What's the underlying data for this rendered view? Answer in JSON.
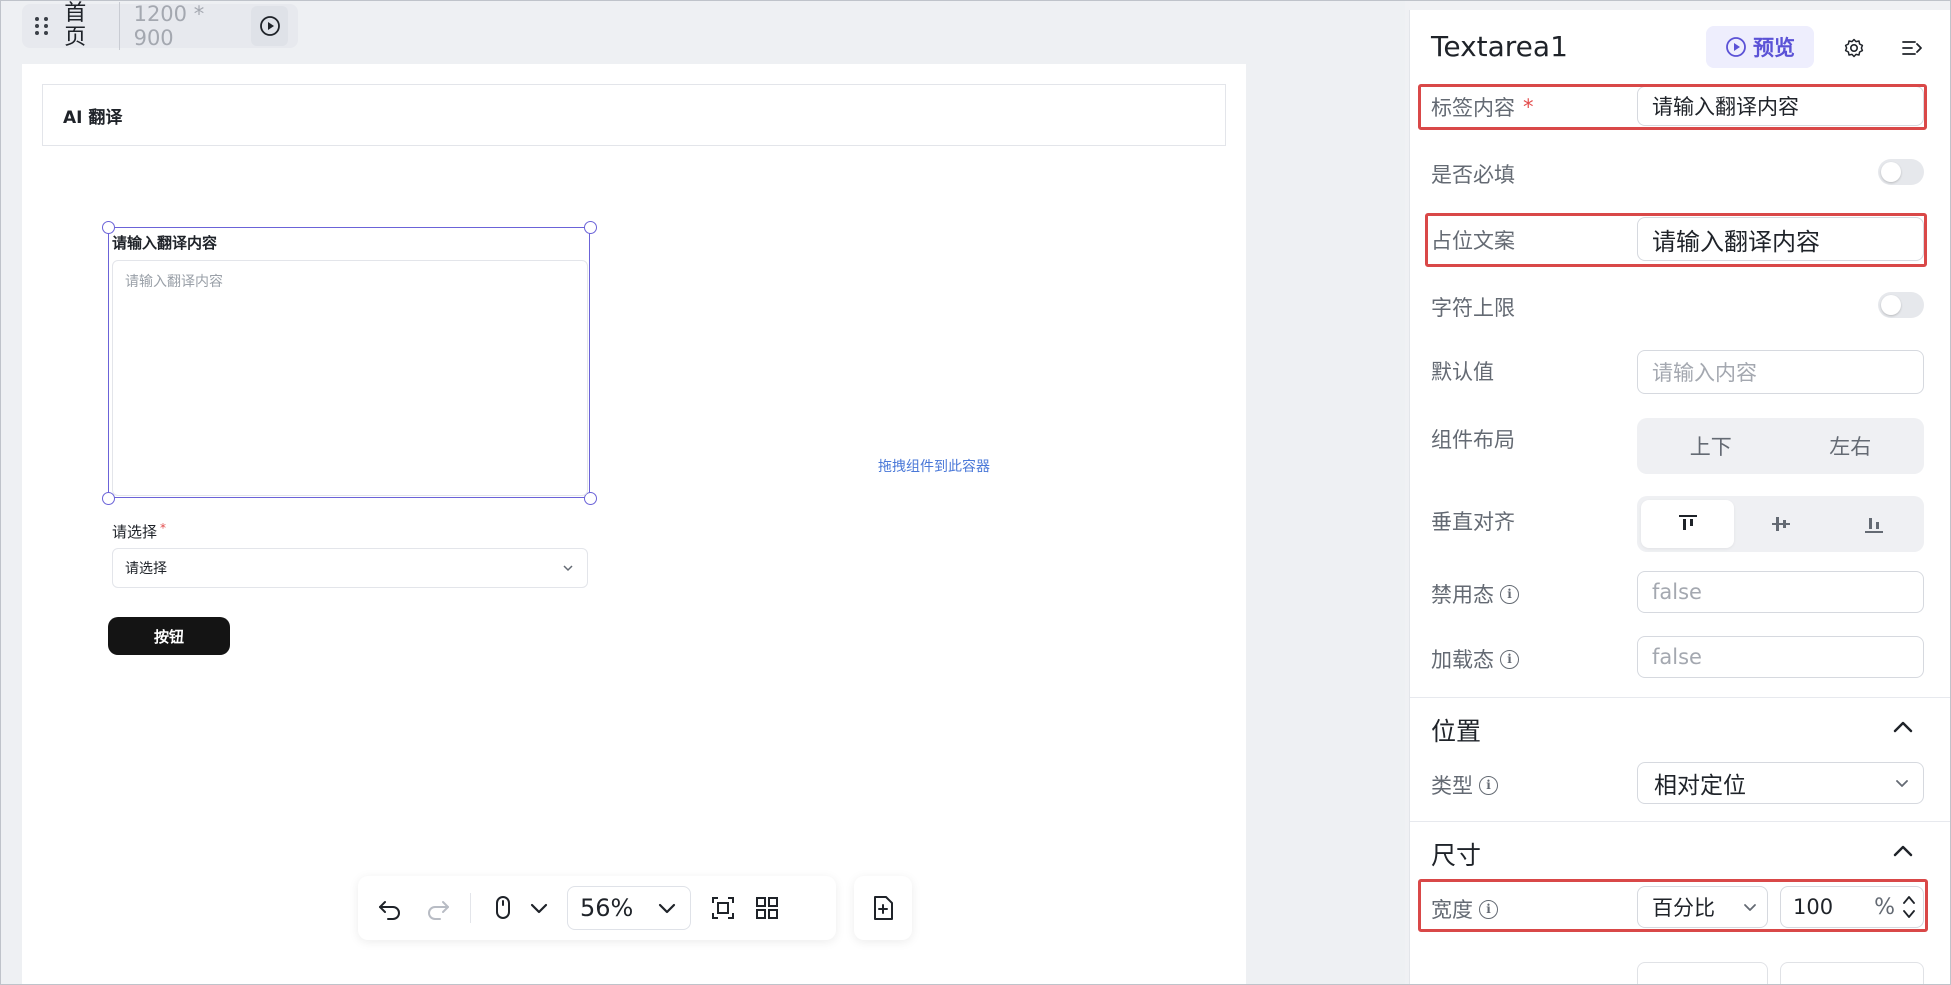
{
  "topbar": {
    "home_label": "首页",
    "size_label": "1200 * 900"
  },
  "canvas": {
    "header_title": "AI 翻译",
    "textarea_label": "请输入翻译内容",
    "textarea_placeholder": "请输入翻译内容",
    "select_label": "请选择",
    "select_required_mark": "*",
    "select_value": "请选择",
    "button_label": "按钮",
    "drop_hint": "拖拽组件到此容器"
  },
  "toolbar": {
    "zoom_value": "56%"
  },
  "panel": {
    "title": "Textarea1",
    "preview_label": "预览",
    "rows": {
      "label_content": {
        "label": "标签内容",
        "required_mark": "*",
        "value": "请输入翻译内容"
      },
      "required": {
        "label": "是否必填"
      },
      "placeholder": {
        "label": "占位文案",
        "value": "请输入翻译内容"
      },
      "max_chars": {
        "label": "字符上限"
      },
      "default_value": {
        "label": "默认值",
        "placeholder": "请输入内容"
      },
      "layout": {
        "label": "组件布局",
        "options": [
          "上下",
          "左右"
        ]
      },
      "vertical_align": {
        "label": "垂直对齐"
      },
      "disabled": {
        "label": "禁用态",
        "value": "false"
      },
      "loading": {
        "label": "加载态",
        "value": "false"
      }
    },
    "position_section": {
      "title": "位置",
      "type_label": "类型",
      "type_value": "相对定位"
    },
    "size_section": {
      "title": "尺寸",
      "width_label": "宽度",
      "width_mode": "百分比",
      "width_value": "100",
      "width_unit": "%"
    }
  },
  "colors": {
    "accent": "#5b52d6",
    "highlight": "#d94848",
    "selection": "#6b63d8"
  }
}
